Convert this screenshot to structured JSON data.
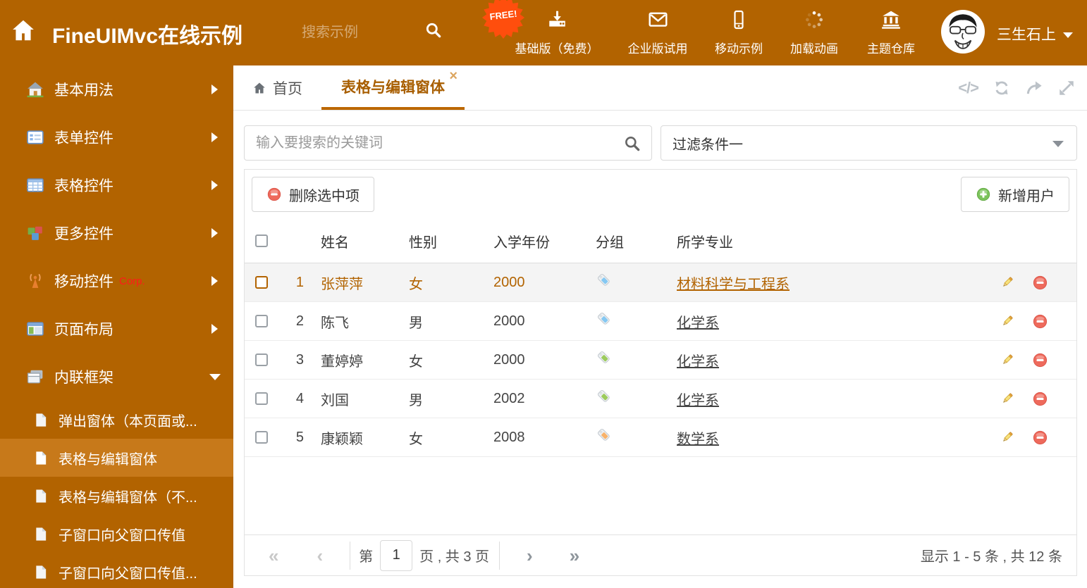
{
  "header": {
    "title": "FineUIMvc在线示例",
    "search_placeholder": "搜索示例",
    "free_badge": "FREE!",
    "nav_items": [
      {
        "label": "基础版（免费）",
        "icon": "download-icon"
      },
      {
        "label": "企业版试用",
        "icon": "envelope-icon"
      },
      {
        "label": "移动示例",
        "icon": "mobile-icon"
      },
      {
        "label": "加载动画",
        "icon": "spinner-icon"
      },
      {
        "label": "主题仓库",
        "icon": "bank-icon"
      }
    ],
    "user_name": "三生石上"
  },
  "sidebar": {
    "items": [
      {
        "label": "基本用法",
        "icon": "home-icon"
      },
      {
        "label": "表单控件",
        "icon": "form-icon"
      },
      {
        "label": "表格控件",
        "icon": "table-icon"
      },
      {
        "label": "更多控件",
        "icon": "cubes-icon"
      },
      {
        "label": "移动控件",
        "badge": "Corp.",
        "icon": "antenna-icon"
      },
      {
        "label": "页面布局",
        "icon": "layout-icon"
      },
      {
        "label": "内联框架",
        "icon": "frames-icon"
      }
    ],
    "subitems": [
      {
        "label": "弹出窗体（本页面或..."
      },
      {
        "label": "表格与编辑窗体"
      },
      {
        "label": "表格与编辑窗体（不..."
      },
      {
        "label": "子窗口向父窗口传值"
      },
      {
        "label": "子窗口向父窗口传值..."
      }
    ]
  },
  "tabs": [
    {
      "label": "首页"
    },
    {
      "label": "表格与编辑窗体"
    }
  ],
  "icons": {
    "close": "×",
    "code": "</>"
  },
  "filters": {
    "search_placeholder": "输入要搜索的关键词",
    "filter_value": "过滤条件一"
  },
  "toolbar": {
    "delete_label": "删除选中项",
    "add_label": "新增用户"
  },
  "table": {
    "columns": [
      "姓名",
      "性别",
      "入学年份",
      "分组",
      "所学专业"
    ],
    "rows": [
      {
        "index": "1",
        "name": "张萍萍",
        "gender": "女",
        "year": "2000",
        "tag_color": "#85C8F2",
        "major": "材料科学与工程系"
      },
      {
        "index": "2",
        "name": "陈飞",
        "gender": "男",
        "year": "2000",
        "tag_color": "#85C8F2",
        "major": "化学系"
      },
      {
        "index": "3",
        "name": "董婷婷",
        "gender": "女",
        "year": "2000",
        "tag_color": "#9CCB5C",
        "major": "化学系"
      },
      {
        "index": "4",
        "name": "刘国",
        "gender": "男",
        "year": "2002",
        "tag_color": "#9CCB5C",
        "major": "化学系"
      },
      {
        "index": "5",
        "name": "康颖颖",
        "gender": "女",
        "year": "2008",
        "tag_color": "#F8B26A",
        "major": "数学系"
      }
    ]
  },
  "pagination": {
    "first": "«",
    "prev": "‹",
    "next": "›",
    "last": "»",
    "page_prefix": "第",
    "page_value": "1",
    "page_suffix": "页 , 共 3 页",
    "summary": "显示 1 - 5 条 , 共 12 条"
  },
  "colors": {
    "theme": "#B26300",
    "sidebar_active": "#C7791A",
    "tab_underline": "#BC6700",
    "free_badge": "#FF4E0D",
    "danger": "#EE6A5C",
    "success": "#7CC35C"
  }
}
